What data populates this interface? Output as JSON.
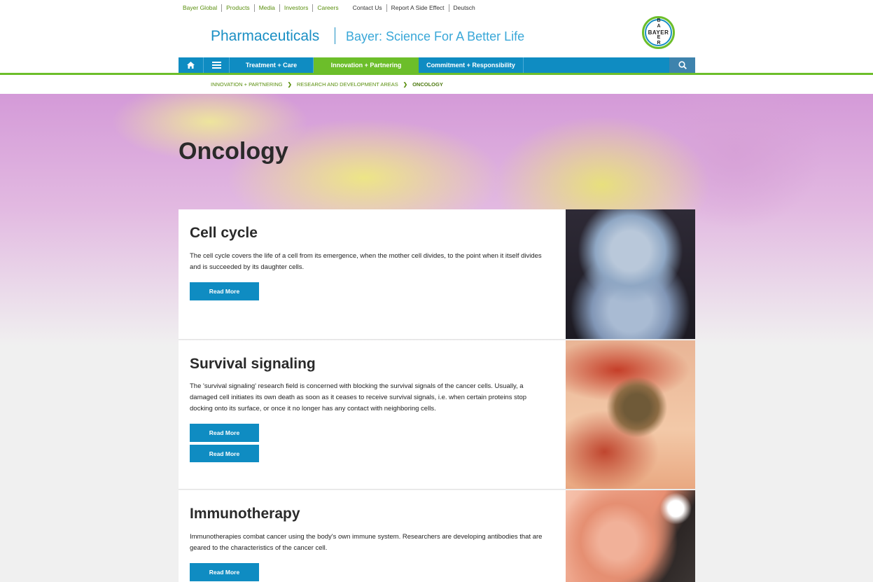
{
  "top_links": {
    "primary": [
      "Bayer Global",
      "Products",
      "Media",
      "Investors",
      "Careers"
    ],
    "secondary": [
      "Contact Us",
      "Report A Side Effect",
      "Deutsch"
    ]
  },
  "header": {
    "brand": "Pharmaceuticals",
    "tagline": "Bayer: Science For A Better Life",
    "logo_text_h": "BAYER",
    "logo_text_v": [
      "B",
      "A",
      "Y",
      "E",
      "R"
    ]
  },
  "nav": {
    "home_icon": "home-icon",
    "menu_icon": "menu-icon",
    "items": [
      "Treatment + Care",
      "Innovation + Partnering",
      "Commitment + Responsibility"
    ],
    "active_index": 1,
    "search_icon": "search-icon"
  },
  "breadcrumb": [
    "INNOVATION + PARTNERING",
    "RESEARCH AND DEVELOPMENT AREAS",
    "ONCOLOGY"
  ],
  "page_title": "Oncology",
  "cards": [
    {
      "title": "Cell cycle",
      "text": "The cell cycle covers the life of a cell from its emergence, when the mother cell divides, to the point when it itself divides and is succeeded by its daughter cells.",
      "buttons": [
        "Read More"
      ]
    },
    {
      "title": "Survival signaling",
      "text": "The 'survival signaling' research field is concerned with blocking the survival signals of the cancer cells. Usually, a damaged cell initiates its own death as soon as it ceases to receive survival signals, i.e. when certain proteins stop docking onto its surface, or once it no longer has any contact with neighboring cells.",
      "buttons": [
        "Read More",
        "Read More"
      ]
    },
    {
      "title": "Immunotherapy",
      "text": "Immunotherapies combat cancer using the body's own immune system. Researchers are developing antibodies that are geared to the characteristics of the cancer cell.",
      "buttons": [
        "Read More"
      ]
    }
  ],
  "colors": {
    "primary_blue": "#0f8cc2",
    "green": "#6cbe2a",
    "link_green": "#5a8f0e"
  }
}
